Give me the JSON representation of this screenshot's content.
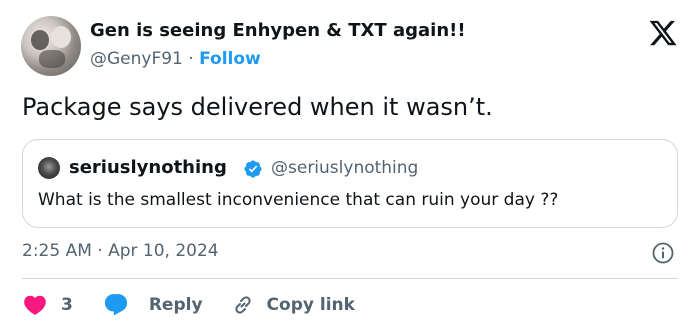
{
  "author": {
    "display_name": "Gen is seeing Enhypen & TXT again!!",
    "handle": "@GenyF91",
    "separator": "·",
    "follow_label": "Follow"
  },
  "tweet": {
    "text": "Package says delivered when it wasn’t.",
    "timestamp": "2:25 AM · Apr 10, 2024"
  },
  "quoted_tweet": {
    "display_name": "seriuslynothing",
    "handle": "@seriuslynothing",
    "verified": true,
    "text": "What is the smallest inconvenience that can ruin your day ??"
  },
  "actions": {
    "like_count": "3",
    "reply_label": "Reply",
    "copy_link_label": "Copy link"
  },
  "colors": {
    "accent": "#1d9bf0",
    "like": "#f91880",
    "secondary_text": "#536471",
    "primary_text": "#0f1419",
    "border": "#cfd9de"
  },
  "icons": {
    "brand": "x-logo-icon",
    "info": "info-icon",
    "like": "heart-icon",
    "reply": "reply-bubble-icon",
    "copy_link": "link-icon",
    "verified": "verified-badge-icon"
  }
}
